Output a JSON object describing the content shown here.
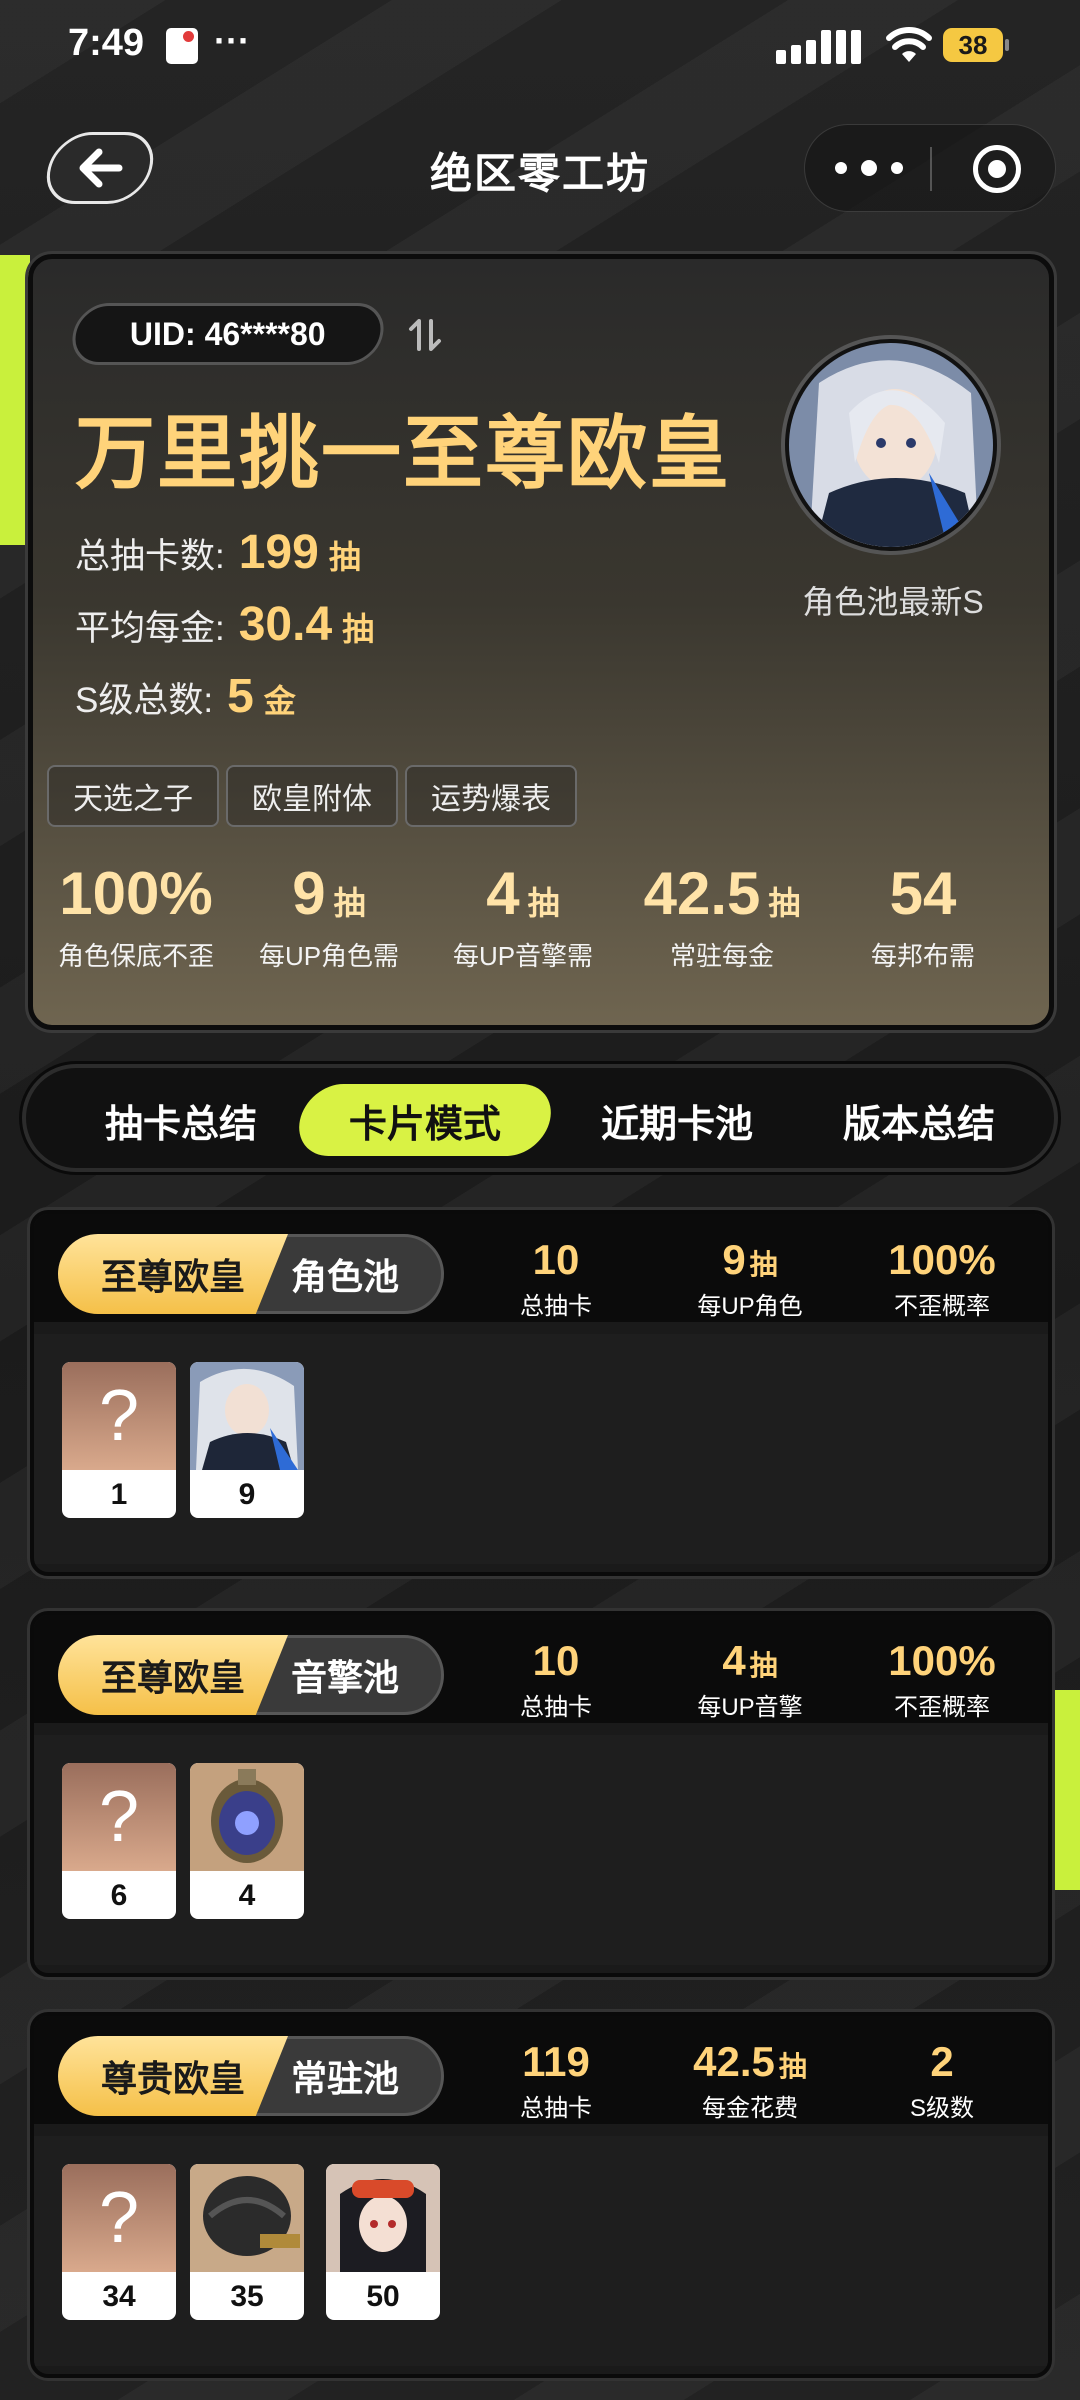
{
  "status_bar": {
    "time": "7:49",
    "dots": "···",
    "battery": "38"
  },
  "nav": {
    "title": "绝区零工坊"
  },
  "summary": {
    "uid": "UID: 46****80",
    "rank_title": "万里挑一至尊欧皇",
    "stats": [
      {
        "label": "总抽卡数:",
        "value": "199",
        "unit": "抽"
      },
      {
        "label": "平均每金:",
        "value": "30.4",
        "unit": "抽"
      },
      {
        "label": "S级总数:",
        "value": "5",
        "unit": "金"
      }
    ],
    "avatar_label": "角色池最新S",
    "tags": [
      "天选之子",
      "欧皇附体",
      "运势爆表"
    ],
    "mini_stats": [
      {
        "value": "100%",
        "unit": "",
        "label": "角色保底不歪"
      },
      {
        "value": "9",
        "unit": "抽",
        "label": "每UP角色需"
      },
      {
        "value": "4",
        "unit": "抽",
        "label": "每UP音擎需"
      },
      {
        "value": "42.5",
        "unit": "抽",
        "label": "常驻每金"
      },
      {
        "value": "54",
        "unit": "",
        "label": "每邦布需"
      }
    ]
  },
  "tabs": [
    "抽卡总结",
    "卡片模式",
    "近期卡池",
    "版本总结"
  ],
  "active_tab": "卡片模式",
  "pools": [
    {
      "rank": "至尊欧皇",
      "name": "角色池",
      "stats": [
        {
          "value": "10",
          "unit": "",
          "label": "总抽卡"
        },
        {
          "value": "9",
          "unit": "抽",
          "label": "每UP角色"
        },
        {
          "value": "100%",
          "unit": "",
          "label": "不歪概率"
        }
      ],
      "cards": [
        {
          "type": "unknown",
          "symbol": "?",
          "count": "1"
        },
        {
          "type": "character",
          "count": "9"
        }
      ]
    },
    {
      "rank": "至尊欧皇",
      "name": "音擎池",
      "stats": [
        {
          "value": "10",
          "unit": "",
          "label": "总抽卡"
        },
        {
          "value": "4",
          "unit": "抽",
          "label": "每UP音擎"
        },
        {
          "value": "100%",
          "unit": "",
          "label": "不歪概率"
        }
      ],
      "cards": [
        {
          "type": "unknown",
          "symbol": "?",
          "count": "6"
        },
        {
          "type": "w-engine",
          "count": "4"
        }
      ]
    },
    {
      "rank": "尊贵欧皇",
      "name": "常驻池",
      "stats": [
        {
          "value": "119",
          "unit": "",
          "label": "总抽卡"
        },
        {
          "value": "42.5",
          "unit": "抽",
          "label": "每金花费"
        },
        {
          "value": "2",
          "unit": "",
          "label": "S级数"
        }
      ],
      "cards": [
        {
          "type": "unknown",
          "symbol": "?",
          "count": "34"
        },
        {
          "type": "helmet",
          "count": "35"
        },
        {
          "type": "character-goggles",
          "count": "50"
        }
      ]
    }
  ],
  "colors": {
    "accent": "#d9f244",
    "gold": "#ffd37a",
    "background": "#1c1c1c"
  }
}
